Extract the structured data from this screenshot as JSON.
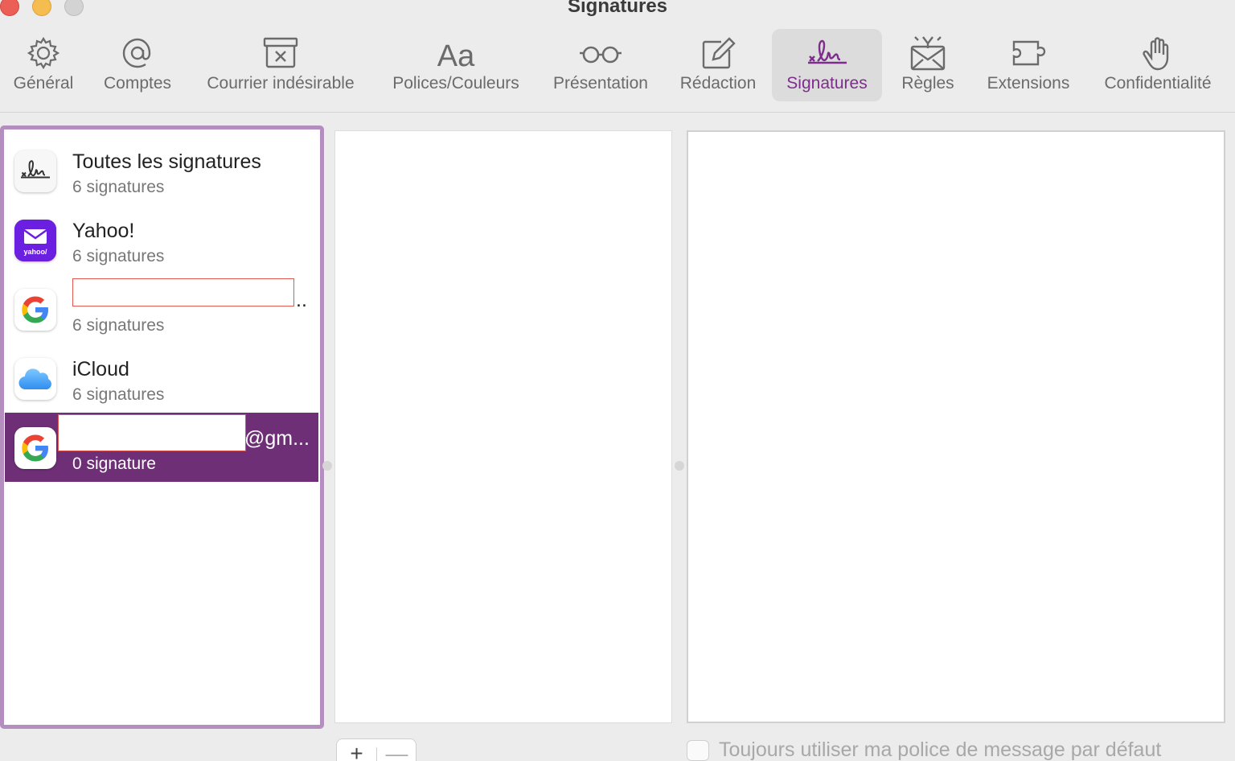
{
  "window": {
    "title": "Signatures"
  },
  "toolbar": {
    "items": [
      {
        "label": "Général",
        "icon": "gear-icon"
      },
      {
        "label": "Comptes",
        "icon": "at-icon"
      },
      {
        "label": "Courrier indésirable",
        "icon": "junk-bin-icon"
      },
      {
        "label": "Polices/Couleurs",
        "icon": "font-aa-icon"
      },
      {
        "label": "Présentation",
        "icon": "glasses-icon"
      },
      {
        "label": "Rédaction",
        "icon": "compose-icon"
      },
      {
        "label": "Signatures",
        "icon": "signature-icon",
        "active": true
      },
      {
        "label": "Règles",
        "icon": "rules-envelope-icon"
      },
      {
        "label": "Extensions",
        "icon": "puzzle-icon"
      },
      {
        "label": "Confidentialité",
        "icon": "hand-icon"
      }
    ],
    "accent_color": "#7e2d8d"
  },
  "accounts": [
    {
      "name": "Toutes les signatures",
      "count": "6 signatures",
      "icon": "signature-app-icon"
    },
    {
      "name": "Yahoo!",
      "count": "6 signatures",
      "icon": "yahoo-mail-icon"
    },
    {
      "name": "..",
      "count": "6 signatures",
      "icon": "google-icon"
    },
    {
      "name": "iCloud",
      "count": "6 signatures",
      "icon": "icloud-icon"
    },
    {
      "name": "@gm...",
      "count": "0 signature",
      "icon": "google-icon",
      "selected": true
    }
  ],
  "controls": {
    "add": "+",
    "remove": "—"
  },
  "options": {
    "default_font_label": "Toujours utiliser ma police de message par défaut"
  },
  "colors": {
    "selection": "#6e2f77",
    "focus_ring": "#b58ec0"
  }
}
